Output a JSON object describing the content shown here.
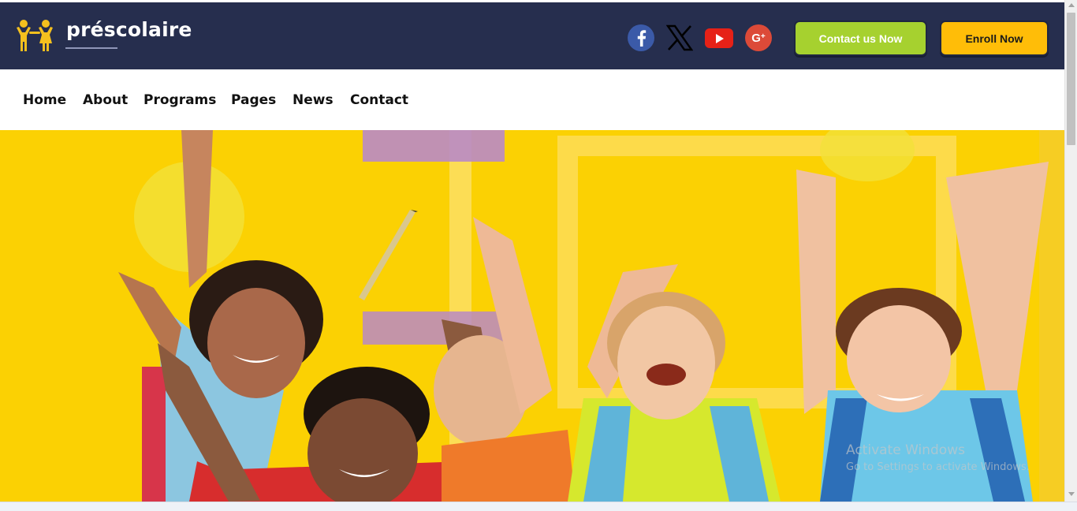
{
  "header": {
    "brand": "préscolaire",
    "logo_icon": "children-icon",
    "social": [
      {
        "name": "facebook-icon",
        "glyph": "f",
        "color": "#3b5aa8"
      },
      {
        "name": "x-icon",
        "glyph": "X",
        "color": "#000000"
      },
      {
        "name": "youtube-icon",
        "glyph": "▶",
        "color": "#e62117"
      },
      {
        "name": "google-plus-icon",
        "glyph": "G+",
        "color": "#dc4a38"
      }
    ],
    "contact_button": "Contact us Now",
    "enroll_button": "Enroll Now",
    "colors": {
      "background": "#262e4e",
      "contact": "#a6d12f",
      "enroll": "#ffbd08"
    }
  },
  "nav": {
    "items": [
      "Home",
      "About",
      "Programs",
      "Pages",
      "News",
      "Contact"
    ]
  },
  "hero": {
    "background": "#fbd103"
  },
  "watermark": {
    "line1": "Activate Windows",
    "line2": "Go to Settings to activate Windows."
  }
}
